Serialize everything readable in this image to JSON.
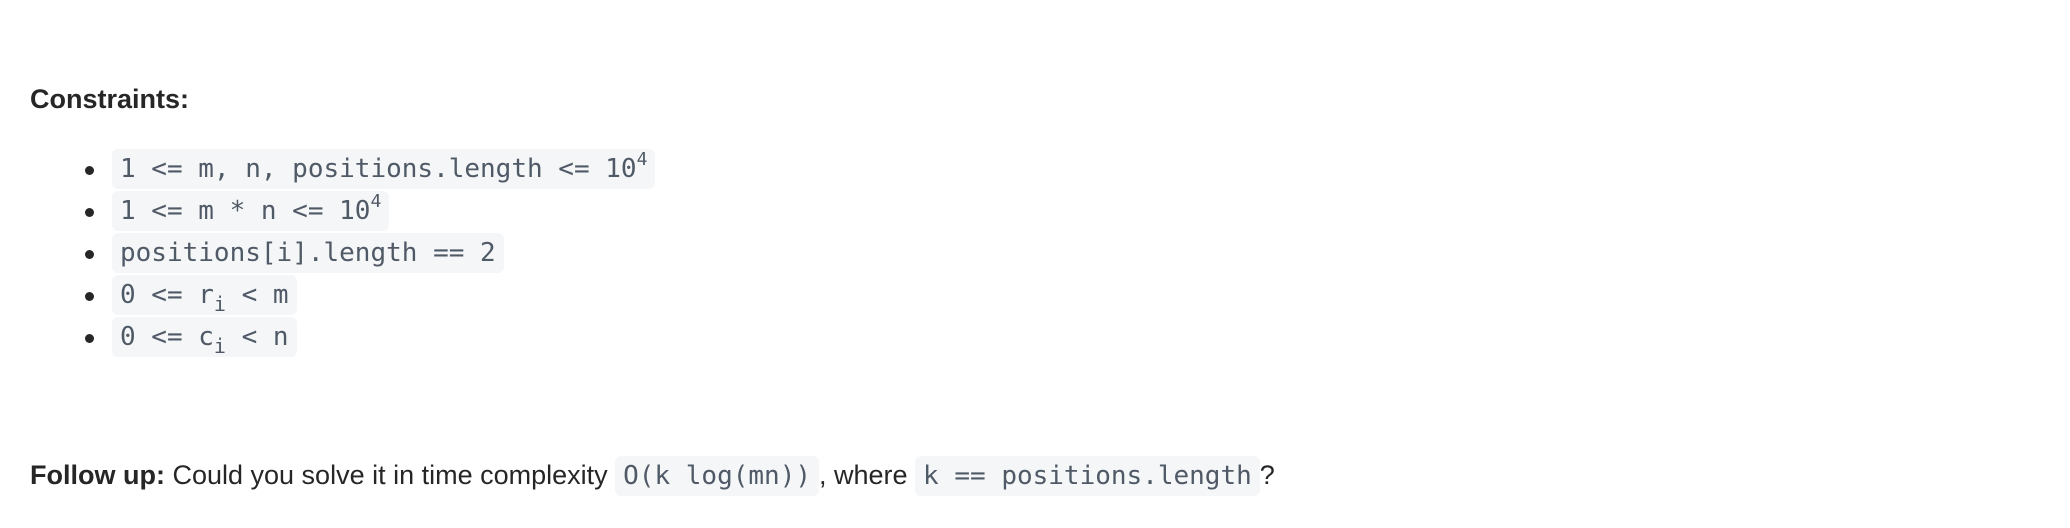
{
  "constraints_heading": "Constraints:",
  "constraints": [
    {
      "code": "1 <= m, n, positions.length <= 10",
      "sup": "4"
    },
    {
      "code": "1 <= m * n <= 10",
      "sup": "4"
    },
    {
      "code": "positions[i].length == 2"
    },
    {
      "pre": "0 <= r",
      "sub": "i",
      "post": " < m"
    },
    {
      "pre": "0 <= c",
      "sub": "i",
      "post": " < n"
    }
  ],
  "followup": {
    "label": "Follow up:",
    "text_before": " Could you solve it in time complexity ",
    "code1": "O(k log(mn))",
    "text_middle": ", where ",
    "code2": "k == positions.length",
    "text_end": "?"
  }
}
